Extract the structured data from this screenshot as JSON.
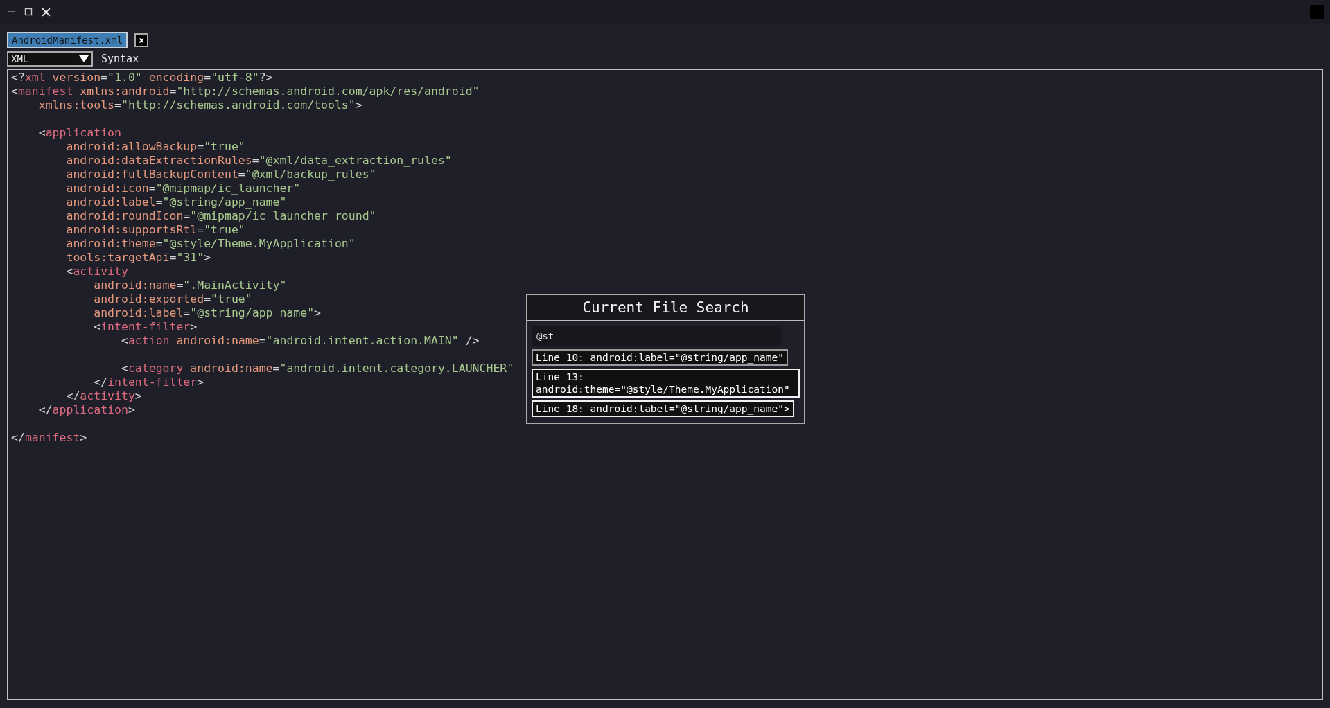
{
  "tab": {
    "label": "AndroidManifest.xml",
    "selected": true,
    "close": "×"
  },
  "syntax": {
    "value": "XML",
    "label": "Syntax"
  },
  "code_lines": [
    {
      "kind": "code",
      "tokens": [
        {
          "kind": "punct",
          "text": "<?"
        },
        {
          "kind": "tag",
          "text": "xml"
        },
        {
          "kind": "attr",
          "text": " version"
        },
        {
          "kind": "punct",
          "text": "="
        },
        {
          "kind": "string",
          "text": "\"1.0\""
        },
        {
          "kind": "attr",
          "text": " encoding"
        },
        {
          "kind": "punct",
          "text": "="
        },
        {
          "kind": "string",
          "text": "\"utf-8\""
        },
        {
          "kind": "punct",
          "text": "?>"
        }
      ]
    },
    {
      "kind": "code",
      "tokens": [
        {
          "kind": "punct",
          "text": "<"
        },
        {
          "kind": "tag",
          "text": "manifest"
        },
        {
          "kind": "attr",
          "text": " xmlns:android"
        },
        {
          "kind": "punct",
          "text": "="
        },
        {
          "kind": "string",
          "text": "\"http://schemas.android.com/apk/res/android\""
        }
      ]
    },
    {
      "kind": "code",
      "tokens": [
        {
          "kind": "attr",
          "text": "    xmlns:tools"
        },
        {
          "kind": "punct",
          "text": "="
        },
        {
          "kind": "string",
          "text": "\"http://schemas.android.com/tools\""
        },
        {
          "kind": "punct",
          "text": ">"
        }
      ]
    },
    {
      "kind": "blank"
    },
    {
      "kind": "code",
      "tokens": [
        {
          "kind": "punct",
          "text": "    <"
        },
        {
          "kind": "tag",
          "text": "application"
        }
      ]
    },
    {
      "kind": "code",
      "tokens": [
        {
          "kind": "attr",
          "text": "        android:allowBackup"
        },
        {
          "kind": "punct",
          "text": "="
        },
        {
          "kind": "string",
          "text": "\"true\""
        }
      ]
    },
    {
      "kind": "code",
      "tokens": [
        {
          "kind": "attr",
          "text": "        android:dataExtractionRules"
        },
        {
          "kind": "punct",
          "text": "="
        },
        {
          "kind": "string",
          "text": "\"@xml/data_extraction_rules\""
        }
      ]
    },
    {
      "kind": "code",
      "tokens": [
        {
          "kind": "attr",
          "text": "        android:fullBackupContent"
        },
        {
          "kind": "punct",
          "text": "="
        },
        {
          "kind": "string",
          "text": "\"@xml/backup_rules\""
        }
      ]
    },
    {
      "kind": "code",
      "tokens": [
        {
          "kind": "attr",
          "text": "        android:icon"
        },
        {
          "kind": "punct",
          "text": "="
        },
        {
          "kind": "string",
          "text": "\"@mipmap/ic_launcher\""
        }
      ]
    },
    {
      "kind": "code",
      "tokens": [
        {
          "kind": "attr",
          "text": "        android:label"
        },
        {
          "kind": "punct",
          "text": "="
        },
        {
          "kind": "string",
          "text": "\"@string/app_name\""
        }
      ]
    },
    {
      "kind": "code",
      "tokens": [
        {
          "kind": "attr",
          "text": "        android:roundIcon"
        },
        {
          "kind": "punct",
          "text": "="
        },
        {
          "kind": "string",
          "text": "\"@mipmap/ic_launcher_round\""
        }
      ]
    },
    {
      "kind": "code",
      "tokens": [
        {
          "kind": "attr",
          "text": "        android:supportsRtl"
        },
        {
          "kind": "punct",
          "text": "="
        },
        {
          "kind": "string",
          "text": "\"true\""
        }
      ]
    },
    {
      "kind": "code",
      "tokens": [
        {
          "kind": "attr",
          "text": "        android:theme"
        },
        {
          "kind": "punct",
          "text": "="
        },
        {
          "kind": "string",
          "text": "\"@style/Theme.MyApplication\""
        }
      ]
    },
    {
      "kind": "code",
      "tokens": [
        {
          "kind": "attr",
          "text": "        tools:targetApi"
        },
        {
          "kind": "punct",
          "text": "="
        },
        {
          "kind": "string",
          "text": "\"31\""
        },
        {
          "kind": "punct",
          "text": ">"
        }
      ]
    },
    {
      "kind": "code",
      "tokens": [
        {
          "kind": "punct",
          "text": "        <"
        },
        {
          "kind": "tag",
          "text": "activity"
        }
      ]
    },
    {
      "kind": "code",
      "tokens": [
        {
          "kind": "attr",
          "text": "            android:name"
        },
        {
          "kind": "punct",
          "text": "="
        },
        {
          "kind": "string",
          "text": "\".MainActivity\""
        }
      ]
    },
    {
      "kind": "code",
      "tokens": [
        {
          "kind": "attr",
          "text": "            android:exported"
        },
        {
          "kind": "punct",
          "text": "="
        },
        {
          "kind": "string",
          "text": "\"true\""
        }
      ]
    },
    {
      "kind": "code",
      "tokens": [
        {
          "kind": "attr",
          "text": "            android:label"
        },
        {
          "kind": "punct",
          "text": "="
        },
        {
          "kind": "string",
          "text": "\"@string/app_name\""
        },
        {
          "kind": "punct",
          "text": ">"
        }
      ]
    },
    {
      "kind": "code",
      "tokens": [
        {
          "kind": "punct",
          "text": "            <"
        },
        {
          "kind": "tag",
          "text": "intent-filter"
        },
        {
          "kind": "punct",
          "text": ">"
        }
      ]
    },
    {
      "kind": "code",
      "tokens": [
        {
          "kind": "punct",
          "text": "                <"
        },
        {
          "kind": "tag",
          "text": "action"
        },
        {
          "kind": "attr",
          "text": " android:name"
        },
        {
          "kind": "punct",
          "text": "="
        },
        {
          "kind": "string",
          "text": "\"android.intent.action.MAIN\""
        },
        {
          "kind": "punct",
          "text": " />"
        }
      ]
    },
    {
      "kind": "blank"
    },
    {
      "kind": "code",
      "tokens": [
        {
          "kind": "punct",
          "text": "                <"
        },
        {
          "kind": "tag",
          "text": "category"
        },
        {
          "kind": "attr",
          "text": " android:name"
        },
        {
          "kind": "punct",
          "text": "="
        },
        {
          "kind": "string",
          "text": "\"android.intent.category.LAUNCHER\""
        }
      ]
    },
    {
      "kind": "code",
      "tokens": [
        {
          "kind": "punct",
          "text": "            </"
        },
        {
          "kind": "tag",
          "text": "intent-filter"
        },
        {
          "kind": "punct",
          "text": ">"
        }
      ]
    },
    {
      "kind": "code",
      "tokens": [
        {
          "kind": "punct",
          "text": "        </"
        },
        {
          "kind": "tag",
          "text": "activity"
        },
        {
          "kind": "punct",
          "text": ">"
        }
      ]
    },
    {
      "kind": "code",
      "tokens": [
        {
          "kind": "punct",
          "text": "    </"
        },
        {
          "kind": "tag",
          "text": "application"
        },
        {
          "kind": "punct",
          "text": ">"
        }
      ]
    },
    {
      "kind": "blank"
    },
    {
      "kind": "code",
      "tokens": [
        {
          "kind": "punct",
          "text": "</"
        },
        {
          "kind": "tag",
          "text": "manifest"
        },
        {
          "kind": "punct",
          "text": ">"
        }
      ]
    }
  ],
  "search_popup": {
    "title": "Current File Search",
    "query": "@st",
    "results": [
      {
        "text": "Line 10: android:label=\"@string/app_name\"",
        "selected": true
      },
      {
        "text": "Line 13: android:theme=\"@style/Theme.MyApplication\"",
        "selected": false
      },
      {
        "text": "Line 18: android:label=\"@string/app_name\">",
        "selected": false
      }
    ]
  }
}
